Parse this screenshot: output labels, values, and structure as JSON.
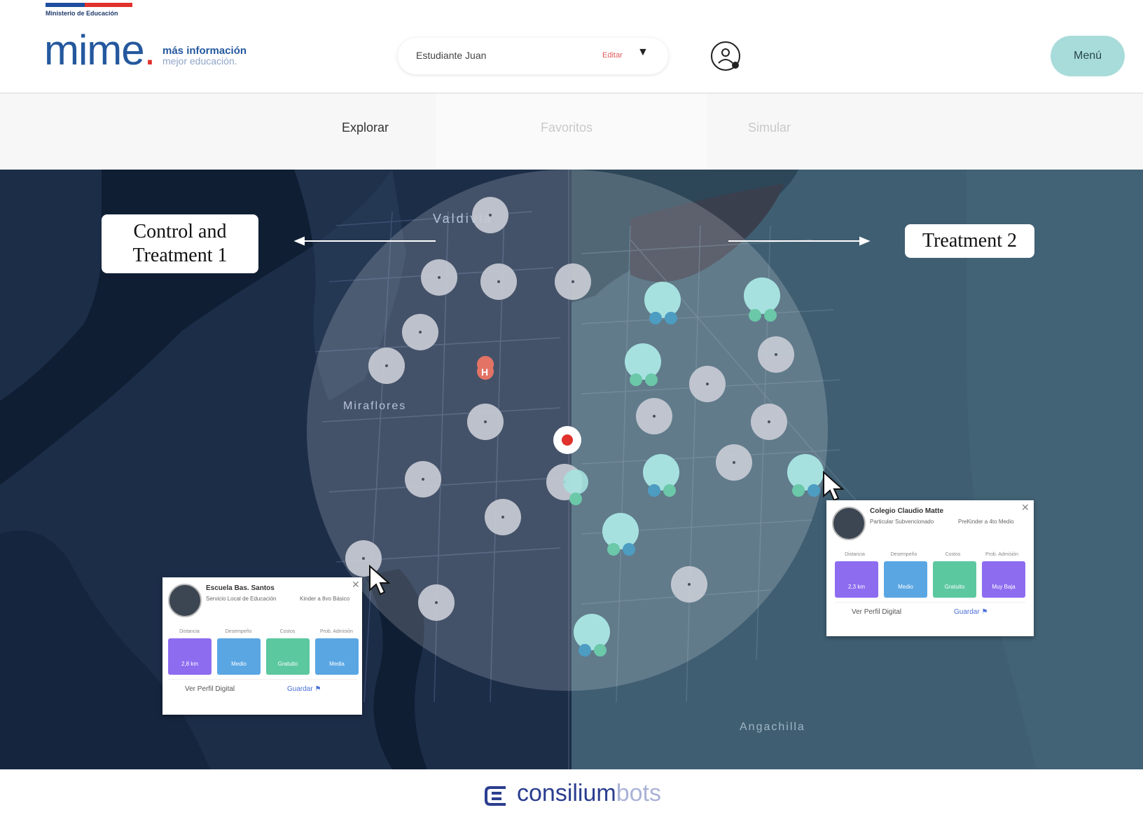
{
  "header": {
    "gov_label": "Ministerio de Educación",
    "logo_main": "mime",
    "logo_dot": ".",
    "tagline_1": "más información",
    "tagline_2": "mejor educación.",
    "student_name": "Estudiante Juan",
    "edit_label": "Editar",
    "menu_label": "Menú",
    "colors": {
      "brand_blue": "#24589e",
      "brand_red": "#e0312b",
      "menu_bg": "#a8dcda"
    }
  },
  "tabs": [
    {
      "label": "Explorar",
      "state": "active"
    },
    {
      "label": "Favoritos",
      "state": "inactive"
    },
    {
      "label": "Simular",
      "state": "inactive"
    }
  ],
  "map": {
    "place_labels": [
      "Valdivia",
      "Miraflores",
      "Angachilla"
    ],
    "annotation_left": [
      "Control and",
      "Treatment 1"
    ],
    "annotation_right": "Treatment 2",
    "colors": {
      "water": "#0f1e33",
      "land_left": "#1c2d48",
      "land_right": "#3f5e72",
      "radius_circle": "#ffffff",
      "school_grey": "#c8cbd4",
      "school_teal": "#a6e1df",
      "user_marker": "#e0312b"
    }
  },
  "card_left": {
    "title": "Escuela Bas. Santos",
    "sub_1": "Servicio Local de Educación",
    "sub_2": "Kinder a 8vo Básico",
    "headers": [
      "Distancia",
      "Desempeño",
      "Costos",
      "Prob. Admisión"
    ],
    "tiles": [
      {
        "text": "2,8 km",
        "color": "#8d6cf0"
      },
      {
        "text": "Medio",
        "color": "#5aa6e3"
      },
      {
        "text": "Gratuito",
        "color": "#5cc8a0"
      },
      {
        "text": "Media",
        "color": "#5aa6e3"
      }
    ],
    "profile_link": "Ver Perfil Digital",
    "save_link": "Guardar"
  },
  "card_right": {
    "title": "Colegio Claudio Matte",
    "sub_1": "Particular Subvencionado",
    "sub_2": "PreKinder a 4to Medio",
    "headers": [
      "Distancia",
      "Desempeño",
      "Costos",
      "Prob. Admisión"
    ],
    "tiles": [
      {
        "text": "2,3 km",
        "color": "#8d6cf0"
      },
      {
        "text": "Medio",
        "color": "#5aa6e3"
      },
      {
        "text": "Gratuito",
        "color": "#5cc8a0"
      },
      {
        "text": "Muy Baja",
        "color": "#8d6cf0"
      }
    ],
    "profile_link": "Ver Perfil Digital",
    "save_link": "Guardar"
  },
  "footer": {
    "brand_main": "consilium",
    "brand_light": "bots"
  }
}
